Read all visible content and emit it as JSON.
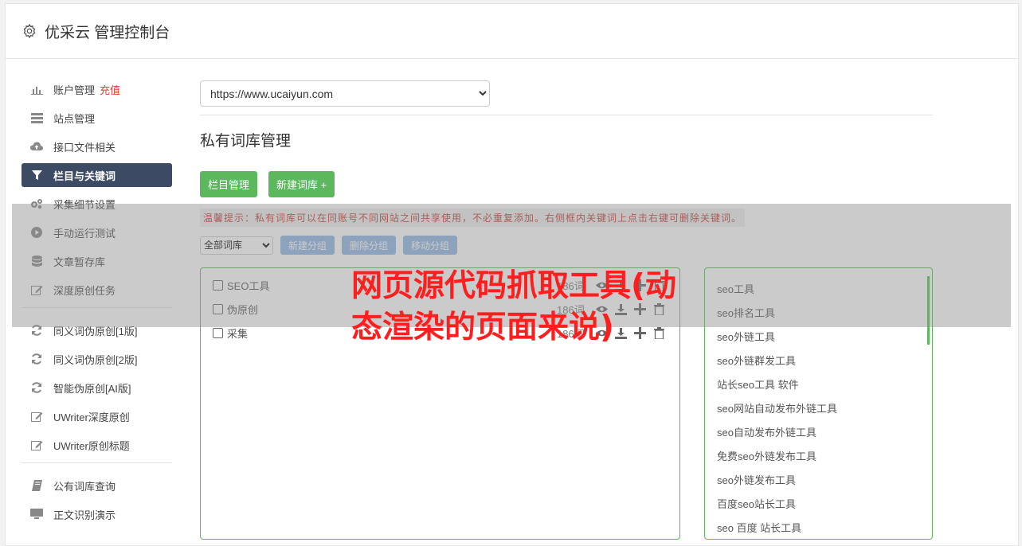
{
  "header": {
    "title": "优采云 管理控制台"
  },
  "sidebar": {
    "group1": [
      {
        "label": "账户管理",
        "badge": "充值",
        "icon": "bar-chart-icon"
      },
      {
        "label": "站点管理",
        "icon": "server-icon"
      },
      {
        "label": "接口文件相关",
        "icon": "cloud-upload-icon"
      },
      {
        "label": "栏目与关键词",
        "icon": "filter-icon",
        "active": true
      },
      {
        "label": "采集细节设置",
        "icon": "gears-icon"
      },
      {
        "label": "手动运行测试",
        "icon": "play-circle-icon"
      },
      {
        "label": "文章暂存库",
        "icon": "database-icon"
      },
      {
        "label": "深度原创任务",
        "icon": "edit-icon"
      }
    ],
    "group2": [
      {
        "label": "同义词伪原创[1版]",
        "icon": "refresh-icon"
      },
      {
        "label": "同义词伪原创[2版]",
        "icon": "refresh-icon"
      },
      {
        "label": "智能伪原创[AI版]",
        "icon": "refresh-icon"
      },
      {
        "label": "UWriter深度原创",
        "icon": "edit-icon"
      },
      {
        "label": "UWriter原创标题",
        "icon": "edit-icon"
      }
    ],
    "group3": [
      {
        "label": "公有词库查询",
        "icon": "book-icon"
      },
      {
        "label": "正文识别演示",
        "icon": "monitor-icon"
      }
    ]
  },
  "main": {
    "site_select": "https://www.ucaiyun.com",
    "section_title": "私有词库管理",
    "buttons": {
      "column_manage": "栏目管理",
      "new_library": "新建词库 +"
    },
    "tip": "温馨提示：私有词库可以在同账号不同网站之间共享使用，不必重复添加。右侧框内关键词上点击右键可删除关键词。",
    "filter_select": "全部词库",
    "group_buttons": {
      "new_group": "新建分组",
      "delete_group": "删除分组",
      "move_group": "移动分组"
    },
    "libraries": [
      {
        "name": "SEO工具",
        "count": "186词"
      },
      {
        "name": "伪原创",
        "count": "186词"
      },
      {
        "name": "采集",
        "count": "186词"
      }
    ],
    "keywords": [
      "seo工具",
      "seo排名工具",
      "seo外链工具",
      "seo外链群发工具",
      "站长seo工具 软件",
      "seo网站自动发布外链工具",
      "seo自动发布外链工具",
      "免费seo外链发布工具",
      "seo外链发布工具",
      "百度seo站长工具",
      "seo 百度 站长工具"
    ]
  },
  "overlay": {
    "title": "网页源代码抓取工具(动态渲染的页面来说)"
  },
  "colors": {
    "accent_green": "#5cb85c",
    "active_nav": "#3c4a64",
    "overlay_red": "#ff1e1e",
    "tip_red": "#c0392b"
  }
}
